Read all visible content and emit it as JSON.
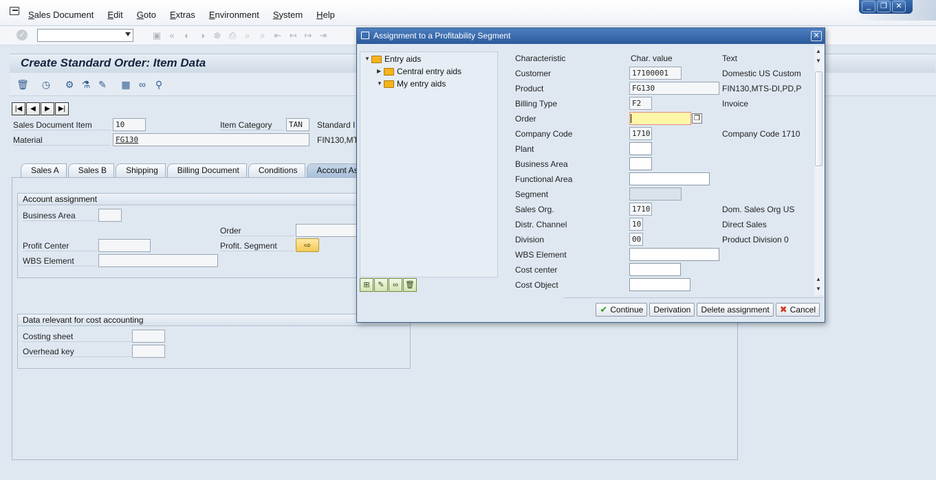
{
  "menu": [
    "Sales Document",
    "Edit",
    "Goto",
    "Extras",
    "Environment",
    "System",
    "Help"
  ],
  "window_controls": {
    "minimize": "_",
    "restore": "❐",
    "close": "✕"
  },
  "screen": {
    "title": "Create Standard Order: Item Data",
    "item_label": "Sales Document Item",
    "item_value": "10",
    "item_category_label": "Item Category",
    "item_category_value": "TAN",
    "item_category_text": "Standard I",
    "material_label": "Material",
    "material_value": "FG130",
    "material_text": "FIN130,MT"
  },
  "tabs": [
    "Sales A",
    "Sales B",
    "Shipping",
    "Billing Document",
    "Conditions",
    "Account As"
  ],
  "account_assignment": {
    "header": "Account assignment",
    "business_area_label": "Business Area",
    "order_label": "Order",
    "profit_center_label": "Profit Center",
    "profit_segment_label": "Profit. Segment",
    "wbs_label": "WBS Element"
  },
  "cost_accounting": {
    "header": "Data relevant for cost accounting",
    "costing_sheet_label": "Costing sheet",
    "overhead_key_label": "Overhead key"
  },
  "dialog": {
    "title": "Assignment to a Profitability Segment",
    "tree": {
      "root": "Entry aids",
      "children": [
        "Central entry aids",
        "My entry aids"
      ]
    },
    "columns": {
      "characteristic": "Characteristic",
      "value": "Char. value",
      "text": "Text"
    },
    "rows": [
      {
        "label": "Customer",
        "value": "17100001",
        "text": "Domestic US Custom"
      },
      {
        "label": "Product",
        "value": "FG130",
        "text": "FIN130,MTS-DI,PD,P"
      },
      {
        "label": "Billing Type",
        "value": "F2",
        "text": "Invoice"
      },
      {
        "label": "Order",
        "value": "",
        "text": ""
      },
      {
        "label": "Company Code",
        "value": "1710",
        "text": "Company Code 1710"
      },
      {
        "label": "Plant",
        "value": "",
        "text": ""
      },
      {
        "label": "Business Area",
        "value": "",
        "text": ""
      },
      {
        "label": "Functional Area",
        "value": "",
        "text": ""
      },
      {
        "label": "Segment",
        "value": "",
        "text": ""
      },
      {
        "label": "Sales Org.",
        "value": "1710",
        "text": "Dom. Sales Org US"
      },
      {
        "label": "Distr. Channel",
        "value": "10",
        "text": "Direct Sales"
      },
      {
        "label": "Division",
        "value": "00",
        "text": "Product Division 0"
      },
      {
        "label": "WBS Element",
        "value": "",
        "text": ""
      },
      {
        "label": "Cost center",
        "value": "",
        "text": ""
      },
      {
        "label": "Cost Object",
        "value": "",
        "text": ""
      }
    ],
    "buttons": {
      "continue": "Continue",
      "derivation": "Derivation",
      "delete": "Delete assignment",
      "cancel": "Cancel"
    }
  }
}
